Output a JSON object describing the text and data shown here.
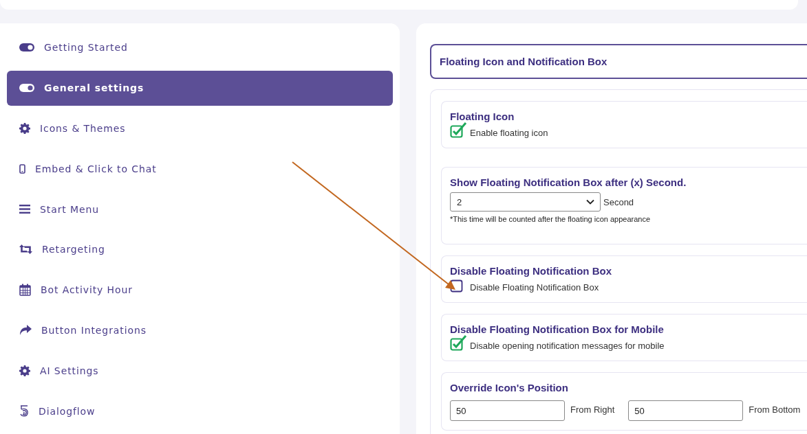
{
  "sidebar": {
    "items": [
      {
        "label": "Getting Started",
        "kind": "toggle",
        "selected": false
      },
      {
        "label": "General settings",
        "kind": "toggle",
        "selected": true
      },
      {
        "label": "Icons & Themes",
        "kind": "gear",
        "selected": false
      },
      {
        "label": "Embed & Click to Chat",
        "kind": "phone",
        "selected": false
      },
      {
        "label": "Start Menu",
        "kind": "menu",
        "selected": false
      },
      {
        "label": "Retargeting",
        "kind": "repeat",
        "selected": false
      },
      {
        "label": "Bot Activity Hour",
        "kind": "calendar",
        "selected": false
      },
      {
        "label": "Button Integrations",
        "kind": "share",
        "selected": false
      },
      {
        "label": "AI Settings",
        "kind": "gear",
        "selected": false
      },
      {
        "label": "Dialogflow",
        "kind": "dialogflow",
        "selected": false
      }
    ]
  },
  "panel": {
    "title": "Floating Icon and Notification Box",
    "sections": [
      {
        "kind": "checkbox",
        "title": "Floating Icon",
        "checkbox": {
          "label": "Enable floating icon",
          "checked": true
        }
      },
      {
        "kind": "select",
        "title": "Show Floating Notification Box after (x) Second.",
        "select": {
          "value": "2"
        },
        "unit": "Second",
        "note": "*This time will be counted after the floating icon appearance"
      },
      {
        "kind": "checkbox",
        "title": "Disable Floating Notification Box",
        "checkbox": {
          "label": "Disable Floating Notification Box",
          "checked": false
        }
      },
      {
        "kind": "checkbox",
        "title": "Disable Floating Notification Box for Mobile",
        "checkbox": {
          "label": "Disable opening notification messages for mobile",
          "checked": true
        }
      },
      {
        "kind": "position",
        "title": "Override Icon's Position",
        "fields": [
          {
            "value": "50",
            "unit": "From Right"
          },
          {
            "value": "50",
            "unit": "From Bottom"
          }
        ]
      }
    ]
  }
}
